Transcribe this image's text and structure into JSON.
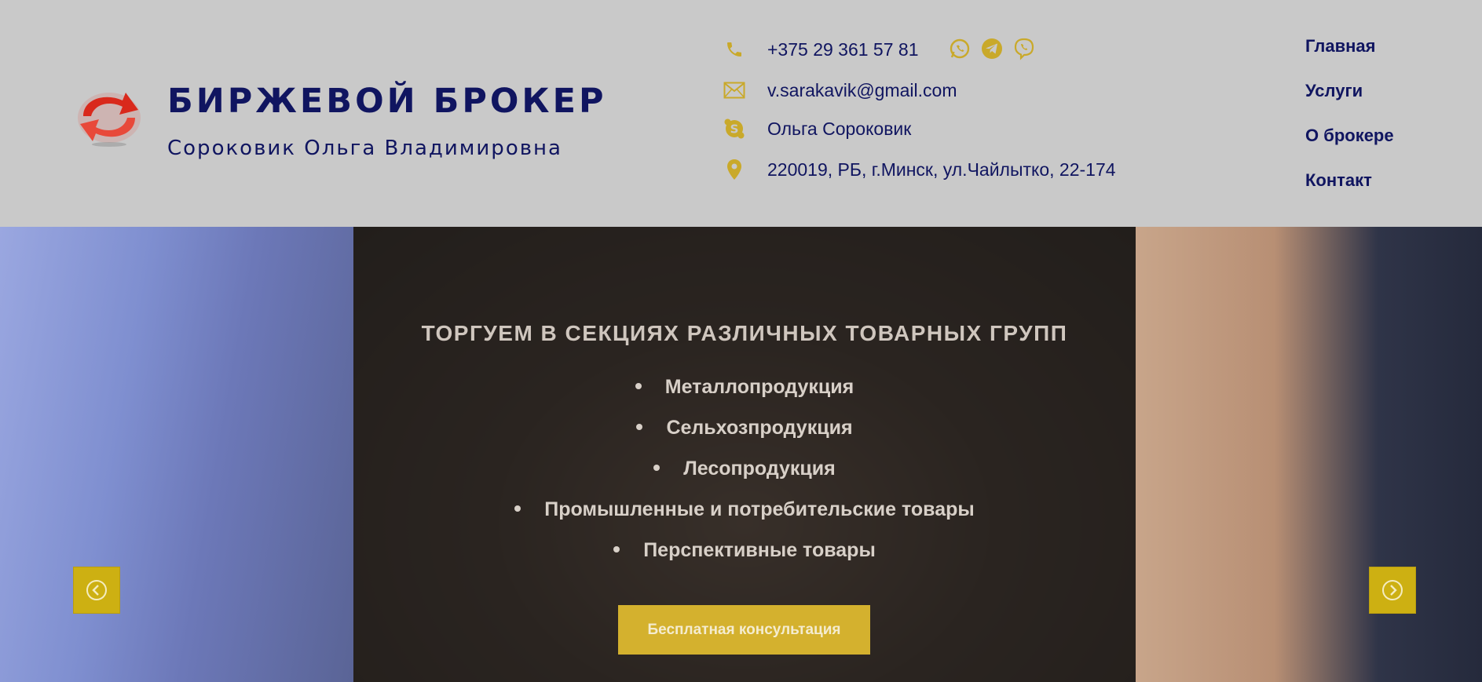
{
  "brand": {
    "title": "БИРЖЕВОЙ БРОКЕР",
    "subtitle": "Сороковик Ольга Владимировна",
    "logo_icon": "exchange-arrows-icon"
  },
  "contacts": {
    "phone": "+375 29 361 57 81",
    "email": "v.sarakavik@gmail.com",
    "skype": "Ольга Сороковик",
    "address": "220019, РБ, г.Минск, ул.Чайлытко, 22-174",
    "icon_color": "#c9a92a",
    "messengers": [
      "whatsapp-icon",
      "telegram-icon",
      "viber-icon"
    ]
  },
  "nav": {
    "items": [
      "Главная",
      "Услуги",
      "О брокере",
      "Контакт"
    ]
  },
  "hero": {
    "title": "ТОРГУЕМ В СЕКЦИЯХ РАЗЛИЧНЫХ ТОВАРНЫХ ГРУПП",
    "list": [
      "Металлопродукция",
      "Сельхозпродукция",
      "Лесопродукция",
      "Промышленные и потребительские товары",
      "Перспективные товары"
    ],
    "cta_label": "Бесплатная консультация",
    "accent_color": "#d4b12e"
  },
  "colors": {
    "brand_text": "#101560",
    "header_bg": "#c9c9c9"
  }
}
